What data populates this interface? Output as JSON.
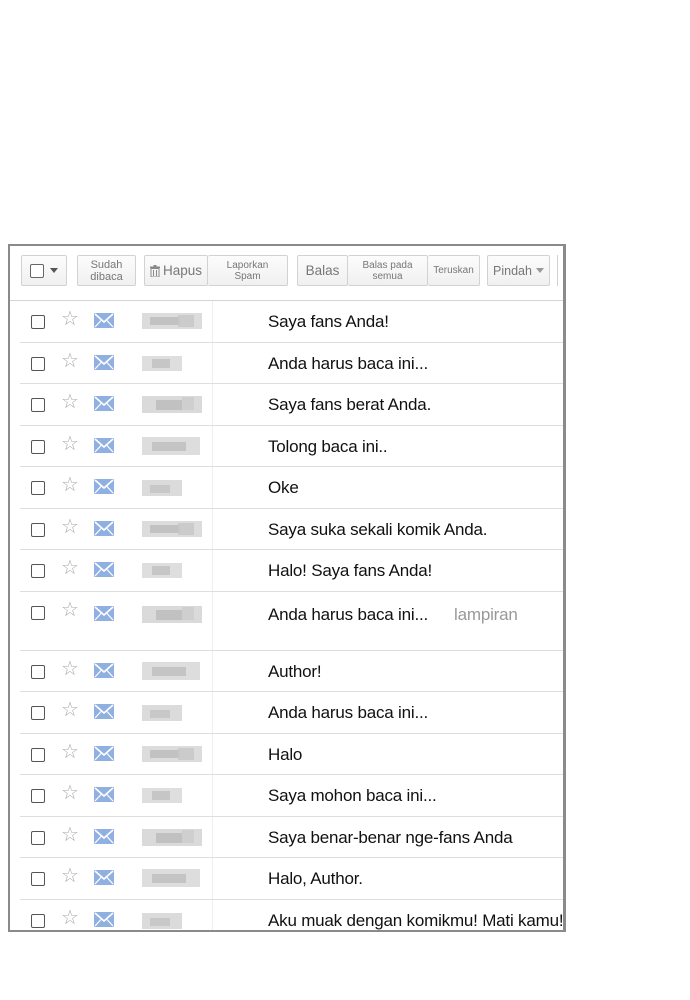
{
  "toolbar": {
    "mark_read": "Sudah dibaca",
    "delete": "Hapus",
    "report_spam": "Laporkan Spam",
    "reply": "Balas",
    "reply_all": "Balas pada semua",
    "forward": "Teruskan",
    "move": "Pindah"
  },
  "emails": [
    {
      "subject": "Saya fans Anda!",
      "attachment": ""
    },
    {
      "subject": "Anda harus baca ini...",
      "attachment": ""
    },
    {
      "subject": "Saya fans berat Anda.",
      "attachment": ""
    },
    {
      "subject": "Tolong baca ini..",
      "attachment": ""
    },
    {
      "subject": "Oke",
      "attachment": ""
    },
    {
      "subject": "Saya suka sekali komik Anda.",
      "attachment": ""
    },
    {
      "subject": "Halo! Saya fans Anda!",
      "attachment": ""
    },
    {
      "subject": "Anda harus baca ini...",
      "attachment": "lampiran"
    },
    {
      "subject": "Author!",
      "attachment": ""
    },
    {
      "subject": "Anda harus baca ini...",
      "attachment": ""
    },
    {
      "subject": "Halo",
      "attachment": ""
    },
    {
      "subject": "Saya mohon baca ini...",
      "attachment": ""
    },
    {
      "subject": "Saya benar-benar nge-fans Anda",
      "attachment": ""
    },
    {
      "subject": "Halo, Author.",
      "attachment": ""
    },
    {
      "subject": "Aku muak dengan komikmu! Mati kamu!",
      "attachment": ""
    }
  ],
  "colors": {
    "envelope": "#8fb0e0",
    "star": "#aaaaaa",
    "attachment_text": "#999999"
  },
  "icons": [
    "checkbox-icon",
    "chevron-down-icon",
    "trash-icon",
    "star-icon",
    "envelope-icon"
  ]
}
